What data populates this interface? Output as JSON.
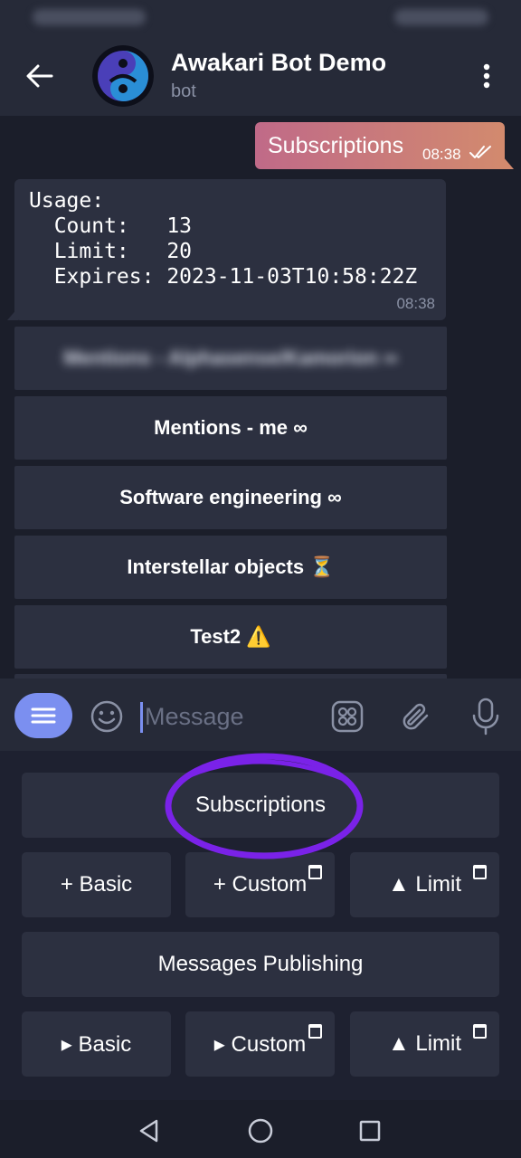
{
  "colors": {
    "header_bg": "#262a38",
    "chat_bg": "#1b1e2a",
    "bubble_in": "#2c3040",
    "bubble_out_start": "#c06a88",
    "bubble_out_end": "#d28a6e",
    "accent": "#7b8ff0",
    "annotation": "#7a22e8"
  },
  "header": {
    "title": "Awakari Bot Demo",
    "subtitle": "bot",
    "back_icon": "arrow-left-icon",
    "more_icon": "more-vert-icon"
  },
  "messages": {
    "outgoing": {
      "text": "Subscriptions",
      "time": "08:38",
      "status_icon": "double-check-icon"
    },
    "incoming": {
      "text": "Usage:\n  Count:   13\n  Limit:   20\n  Expires: 2023-11-03T10:58:22Z",
      "time": "08:38"
    }
  },
  "inline_buttons": [
    {
      "label": "Mentions - Alphasense/Kamorion ∞",
      "blurred": true
    },
    {
      "label": "Mentions - me ∞"
    },
    {
      "label": "Software engineering ∞"
    },
    {
      "label": "Interstellar objects ⏳"
    },
    {
      "label": "Test2 ⚠️"
    }
  ],
  "input": {
    "placeholder": "Message",
    "menu_icon": "menu-icon",
    "emoji_icon": "smile-icon",
    "app_icon": "apps-icon",
    "attach_icon": "paperclip-icon",
    "mic_icon": "microphone-icon"
  },
  "keyboard": {
    "subscriptions": "Subscriptions",
    "sub_basic": "+ Basic",
    "sub_custom": "+ Custom",
    "sub_limit": "▲ Limit",
    "messages_publishing": "Messages Publishing",
    "pub_basic": "▸ Basic",
    "pub_custom": "▸ Custom",
    "pub_limit": "▲ Limit"
  },
  "navbar": {
    "back_icon": "nav-back-icon",
    "home_icon": "nav-home-icon",
    "recents_icon": "nav-recents-icon"
  }
}
